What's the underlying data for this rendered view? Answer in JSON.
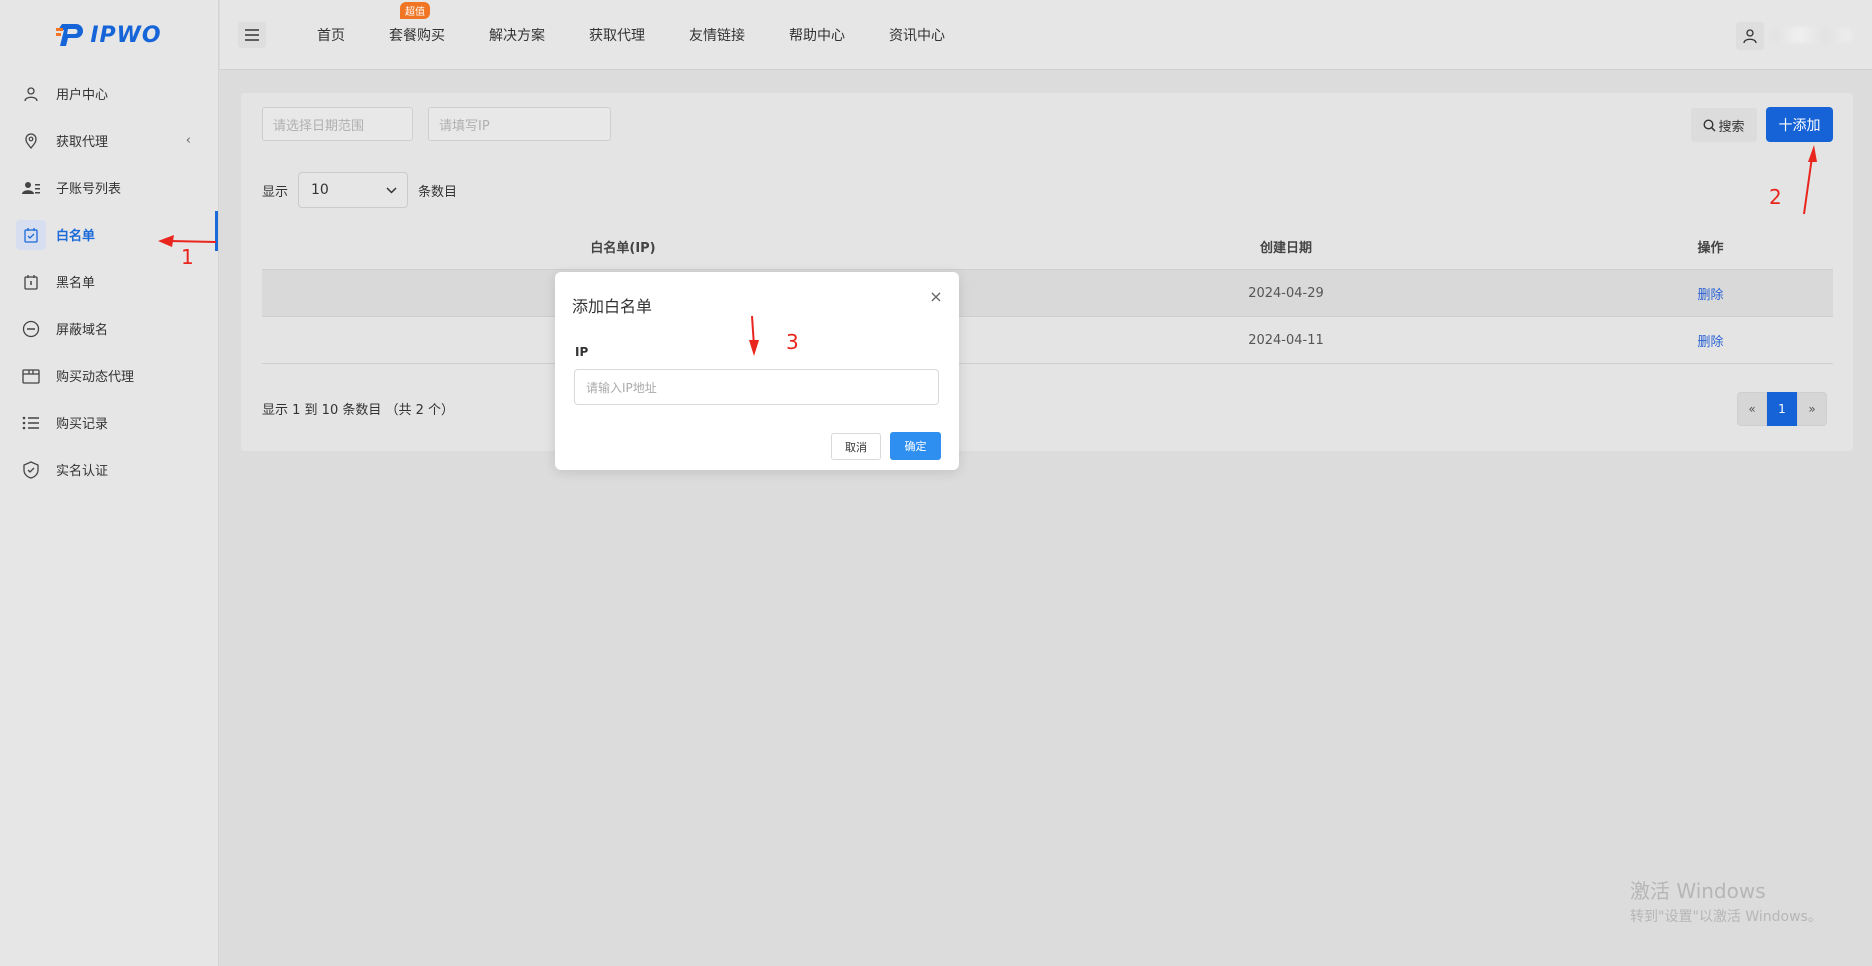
{
  "brand": {
    "name": "IPWO",
    "primary_color": "#1663d7"
  },
  "sidebar": {
    "items": [
      {
        "label": "用户中心",
        "icon": "user-icon",
        "active": false
      },
      {
        "label": "获取代理",
        "icon": "location-pin-icon",
        "active": false,
        "has_submenu": true
      },
      {
        "label": "子账号列表",
        "icon": "contacts-icon",
        "active": false
      },
      {
        "label": "白名单",
        "icon": "calendar-check-icon",
        "active": true
      },
      {
        "label": "黑名单",
        "icon": "calendar-x-icon",
        "active": false
      },
      {
        "label": "屏蔽域名",
        "icon": "minus-circle-icon",
        "active": false
      },
      {
        "label": "购买动态代理",
        "icon": "box-icon",
        "active": false
      },
      {
        "label": "购买记录",
        "icon": "list-icon",
        "active": false
      },
      {
        "label": "实名认证",
        "icon": "shield-check-icon",
        "active": false
      }
    ]
  },
  "topnav": {
    "items": [
      "首页",
      "套餐购买",
      "解决方案",
      "获取代理",
      "友情链接",
      "帮助中心",
      "资讯中心"
    ],
    "badge": "超值"
  },
  "filters": {
    "date_placeholder": "请选择日期范围",
    "ip_placeholder": "请填写IP",
    "search_label": "搜索",
    "add_label": "十添加"
  },
  "page_size": {
    "prefix": "显示",
    "value": "10",
    "suffix": "条数目"
  },
  "table": {
    "headers": [
      "白名单(IP)",
      "创建日期",
      "操作"
    ],
    "rows": [
      {
        "ip": "",
        "date": "2024-04-29",
        "action": "删除"
      },
      {
        "ip": "",
        "date": "2024-04-11",
        "action": "删除"
      }
    ]
  },
  "footer": {
    "info": "显示 1 到 10 条数目 （共 2 个）"
  },
  "pagination": {
    "prev": "«",
    "current": "1",
    "next": "»"
  },
  "modal": {
    "title": "添加白名单",
    "close": "×",
    "field_label": "IP",
    "input_placeholder": "请输入IP地址",
    "cancel_label": "取消",
    "ok_label": "确定"
  },
  "annotations": {
    "n1": "1",
    "n2": "2",
    "n3": "3",
    "color": "#e8261e"
  },
  "watermark": {
    "line1": "激活 Windows",
    "line2": "转到\"设置\"以激活 Windows。"
  }
}
